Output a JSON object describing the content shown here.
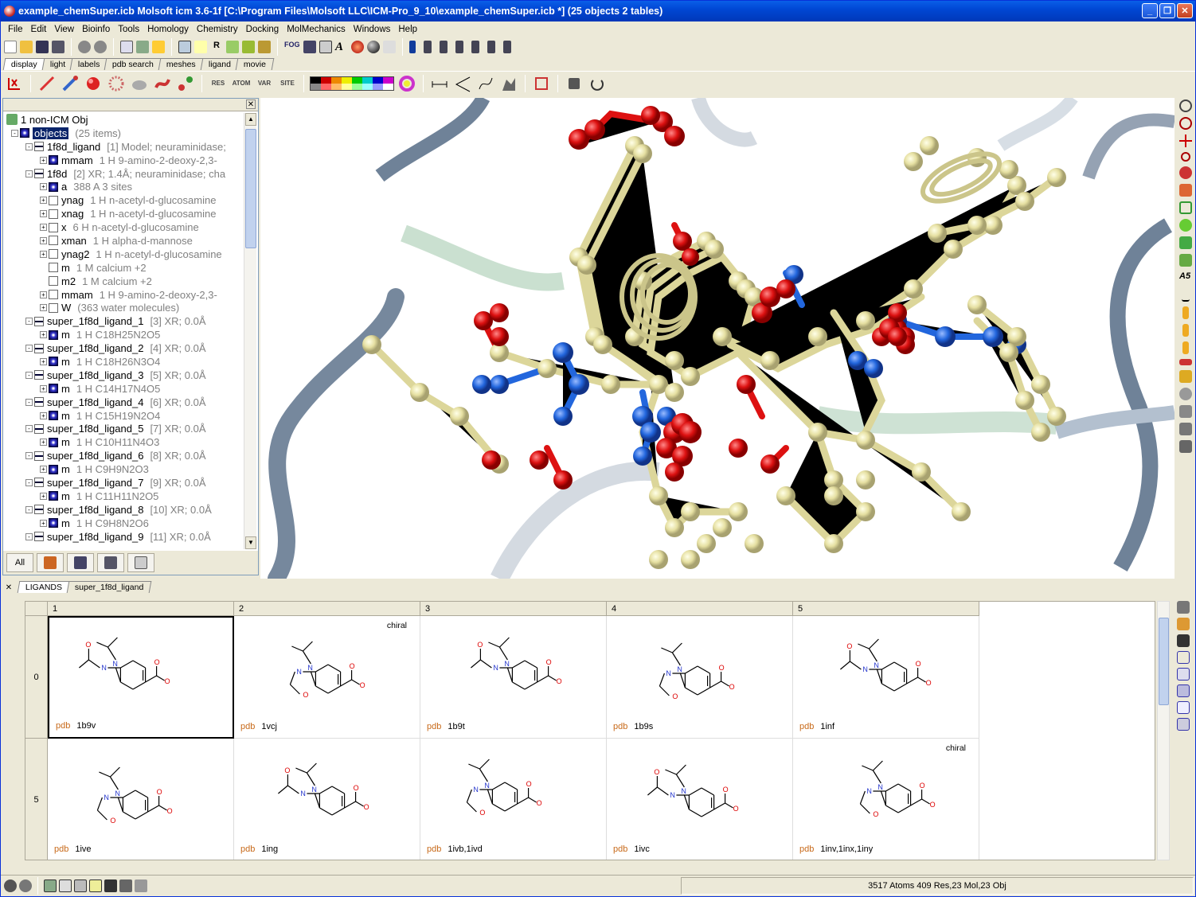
{
  "window": {
    "title": "example_chemSuper.icb Molsoft icm 3.6-1f  [C:\\Program Files\\Molsoft LLC\\ICM-Pro_9_10\\example_chemSuper.icb *] (25 objects 2 tables)"
  },
  "menu": [
    "File",
    "Edit",
    "View",
    "Bioinfo",
    "Tools",
    "Homology",
    "Chemistry",
    "Docking",
    "MolMechanics",
    "Windows",
    "Help"
  ],
  "tabs": [
    "display",
    "light",
    "labels",
    "pdb search",
    "meshes",
    "ligand",
    "movie"
  ],
  "toolbar_texts": {
    "res": "RES",
    "atom": "ATOM",
    "var": "VAR",
    "site": "SITE",
    "fog": "FOG"
  },
  "tree": {
    "header": "1 non-ICM Obj",
    "rows": [
      {
        "name": "objects",
        "info": "(25 items)",
        "indent": 0,
        "box": "on",
        "pm": "-",
        "sel": true
      },
      {
        "name": "1f8d_ligand",
        "info": "[1] Model; neuraminidase;",
        "indent": 1,
        "box": "half",
        "pm": "-"
      },
      {
        "name": "mmam",
        "info": "1 H  9-amino-2-deoxy-2,3-",
        "indent": 2,
        "box": "on",
        "pm": "+"
      },
      {
        "name": "1f8d",
        "info": "[2] XR; 1.4Å; neuraminidase; cha",
        "indent": 1,
        "box": "half",
        "pm": "-"
      },
      {
        "name": "a",
        "info": "388 A  3 sites",
        "indent": 2,
        "box": "on",
        "pm": "+"
      },
      {
        "name": "ynag",
        "info": "1 H  n-acetyl-d-glucosamine",
        "indent": 2,
        "box": "off",
        "pm": "+"
      },
      {
        "name": "xnag",
        "info": "1 H  n-acetyl-d-glucosamine",
        "indent": 2,
        "box": "off",
        "pm": "+"
      },
      {
        "name": "x",
        "info": "6 H  n-acetyl-d-glucosamine",
        "indent": 2,
        "box": "off",
        "pm": "+"
      },
      {
        "name": "xman",
        "info": "1 H  alpha-d-mannose",
        "indent": 2,
        "box": "off",
        "pm": "+"
      },
      {
        "name": "ynag2",
        "info": "1 H  n-acetyl-d-glucosamine",
        "indent": 2,
        "box": "off",
        "pm": "+"
      },
      {
        "name": "m",
        "info": "1 M  calcium +2",
        "indent": 2,
        "box": "off",
        "pm": ""
      },
      {
        "name": "m2",
        "info": "1 M  calcium +2",
        "indent": 2,
        "box": "off",
        "pm": ""
      },
      {
        "name": "mmam",
        "info": "1 H  9-amino-2-deoxy-2,3-",
        "indent": 2,
        "box": "off",
        "pm": "+"
      },
      {
        "name": "W",
        "info": "(363 water molecules)",
        "indent": 2,
        "box": "off",
        "pm": "+"
      },
      {
        "name": "super_1f8d_ligand_1",
        "info": "[3] XR; 0.0Å",
        "indent": 1,
        "box": "half",
        "pm": "-"
      },
      {
        "name": "m",
        "info": "1 H  C18H25N2O5",
        "indent": 2,
        "box": "on",
        "pm": "+"
      },
      {
        "name": "super_1f8d_ligand_2",
        "info": "[4] XR; 0.0Å",
        "indent": 1,
        "box": "half",
        "pm": "-"
      },
      {
        "name": "m",
        "info": "1 H  C18H26N3O4",
        "indent": 2,
        "box": "on",
        "pm": "+"
      },
      {
        "name": "super_1f8d_ligand_3",
        "info": "[5] XR; 0.0Å",
        "indent": 1,
        "box": "half",
        "pm": "-"
      },
      {
        "name": "m",
        "info": "1 H  C14H17N4O5",
        "indent": 2,
        "box": "on",
        "pm": "+"
      },
      {
        "name": "super_1f8d_ligand_4",
        "info": "[6] XR; 0.0Å",
        "indent": 1,
        "box": "half",
        "pm": "-"
      },
      {
        "name": "m",
        "info": "1 H  C15H19N2O4",
        "indent": 2,
        "box": "on",
        "pm": "+"
      },
      {
        "name": "super_1f8d_ligand_5",
        "info": "[7] XR; 0.0Å",
        "indent": 1,
        "box": "half",
        "pm": "-"
      },
      {
        "name": "m",
        "info": "1 H  C10H11N4O3",
        "indent": 2,
        "box": "on",
        "pm": "+"
      },
      {
        "name": "super_1f8d_ligand_6",
        "info": "[8] XR; 0.0Å",
        "indent": 1,
        "box": "half",
        "pm": "-"
      },
      {
        "name": "m",
        "info": "1 H  C9H9N2O3",
        "indent": 2,
        "box": "on",
        "pm": "+"
      },
      {
        "name": "super_1f8d_ligand_7",
        "info": "[9] XR; 0.0Å",
        "indent": 1,
        "box": "half",
        "pm": "-"
      },
      {
        "name": "m",
        "info": "1 H  C11H11N2O5",
        "indent": 2,
        "box": "on",
        "pm": "+"
      },
      {
        "name": "super_1f8d_ligand_8",
        "info": "[10] XR; 0.0Å",
        "indent": 1,
        "box": "half",
        "pm": "-"
      },
      {
        "name": "m",
        "info": "1 H  C9H8N2O6",
        "indent": 2,
        "box": "on",
        "pm": "+"
      },
      {
        "name": "super_1f8d_ligand_9",
        "info": "[11] XR; 0.0Å",
        "indent": 1,
        "box": "half",
        "pm": "-"
      }
    ],
    "bottom_all": "All"
  },
  "bottom_tabs": [
    "LIGANDS",
    "super_1f8d_ligand"
  ],
  "table": {
    "columns": [
      "1",
      "2",
      "3",
      "4",
      "5"
    ],
    "rows": [
      "0",
      "5"
    ],
    "cells": [
      {
        "pdb_label": "pdb",
        "id": "1b9v",
        "chiral": ""
      },
      {
        "pdb_label": "pdb",
        "id": "1vcj",
        "chiral": "chiral"
      },
      {
        "pdb_label": "pdb",
        "id": "1b9t",
        "chiral": ""
      },
      {
        "pdb_label": "pdb",
        "id": "1b9s",
        "chiral": ""
      },
      {
        "pdb_label": "pdb",
        "id": "1inf",
        "chiral": ""
      },
      {
        "pdb_label": "pdb",
        "id": "1ive",
        "chiral": ""
      },
      {
        "pdb_label": "pdb",
        "id": "1ing",
        "chiral": ""
      },
      {
        "pdb_label": "pdb",
        "id": "1ivb,1ivd",
        "chiral": ""
      },
      {
        "pdb_label": "pdb",
        "id": "1ivc",
        "chiral": ""
      },
      {
        "pdb_label": "pdb",
        "id": "1inv,1inx,1iny",
        "chiral": "chiral"
      }
    ]
  },
  "status": {
    "text": "3517 Atoms 409 Res,23 Mol,23 Obj"
  },
  "colors": {
    "titlebar": "#0047d4",
    "oxygen": "#dd1111",
    "nitrogen": "#2266dd",
    "carbon": "#e8e3a8",
    "ribbon": "#6f8298",
    "selection": "#0a246a",
    "pdb_label": "#c86a1a"
  }
}
